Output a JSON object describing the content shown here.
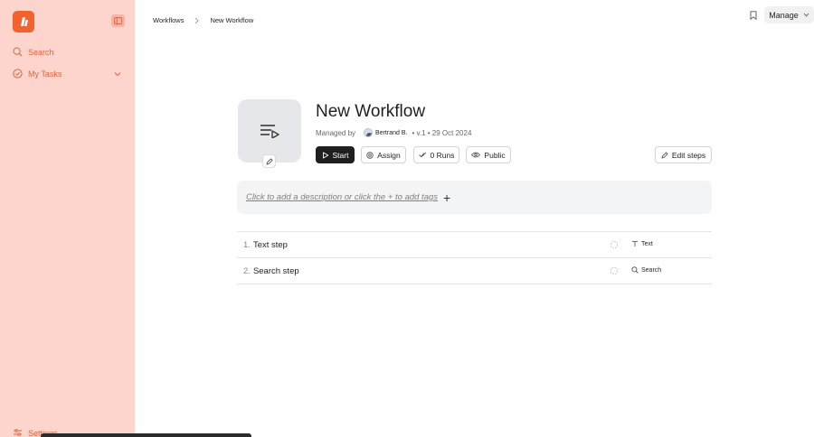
{
  "sidebar": {
    "search_label": "Search",
    "tasks_label": "My Tasks",
    "settings_label": "Settings"
  },
  "breadcrumb": {
    "root": "Workflows",
    "current": "New Workflow"
  },
  "topbar": {
    "manage_label": "Manage"
  },
  "workflow": {
    "title": "New Workflow",
    "managed_by_label": "Managed by",
    "manager": "Bertrand B.",
    "version_date": "• v.1 • 29 Oct 2024"
  },
  "actions": {
    "start": "Start",
    "assign": "Assign",
    "runs": "0 Runs",
    "public": "Public",
    "edit_steps": "Edit steps"
  },
  "description": {
    "placeholder": "Click to add a description or click the + to add tags",
    "plus": "+"
  },
  "steps": [
    {
      "num": "1.",
      "label": "Text step",
      "type": "Text"
    },
    {
      "num": "2.",
      "label": "Search step",
      "type": "Search"
    }
  ],
  "colors": {
    "sidebar_bg": "#fdd5cc",
    "brand": "#f2622e",
    "accent_text": "#e0633f"
  }
}
